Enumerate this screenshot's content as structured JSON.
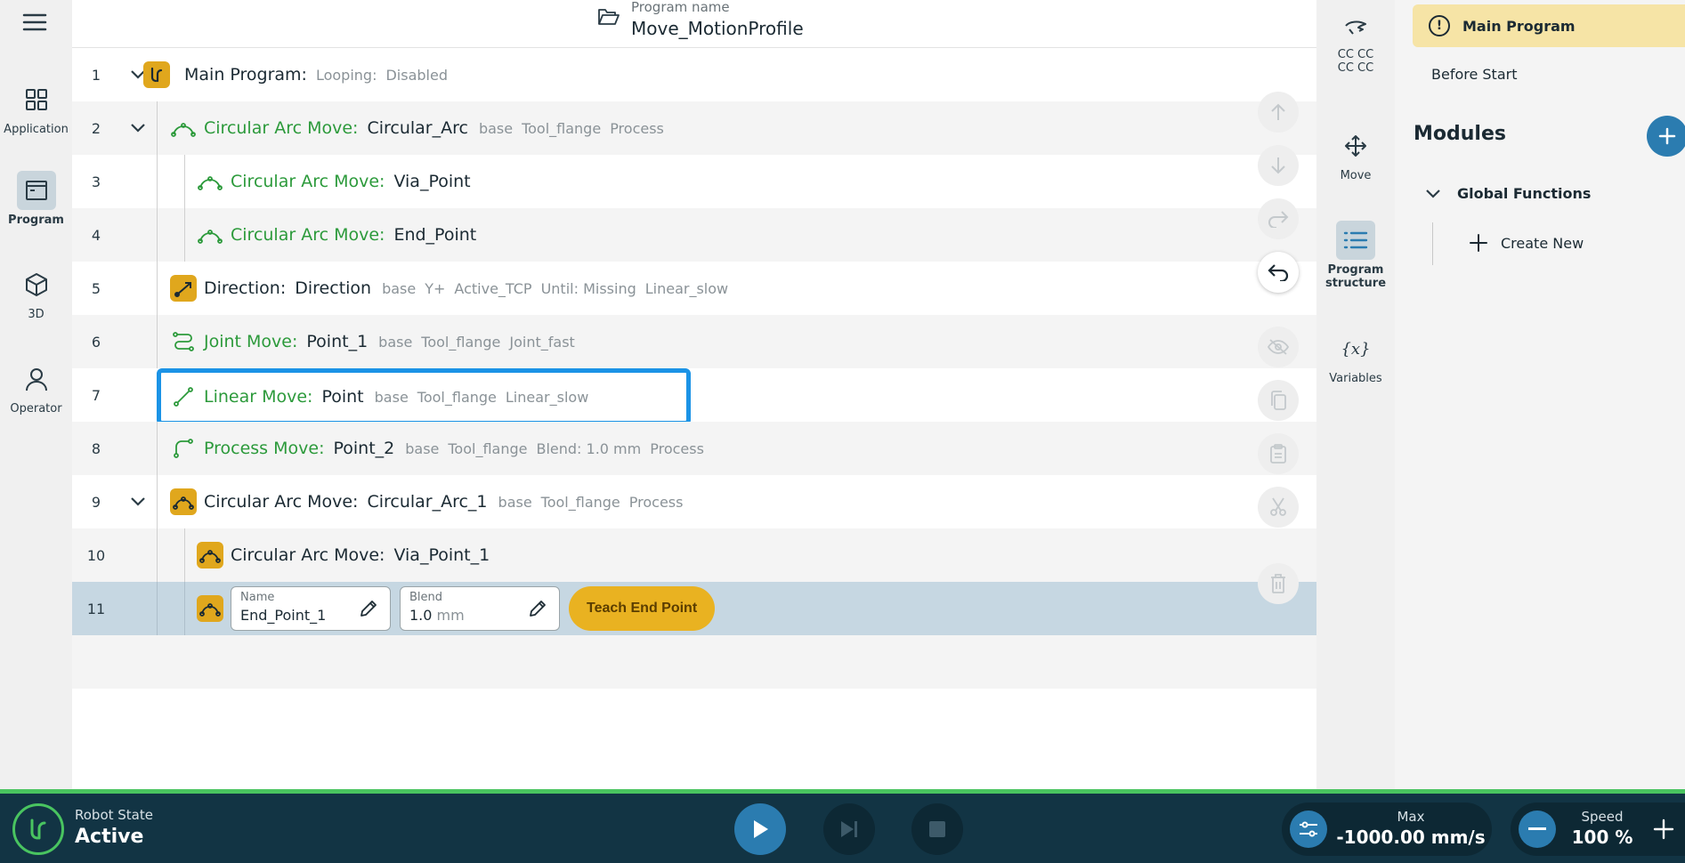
{
  "app": {
    "program_name_label": "Program name",
    "program_name": "Move_MotionProfile"
  },
  "left_nav": [
    {
      "label": "Application",
      "icon": "grid-icon"
    },
    {
      "label": "Program",
      "icon": "program-window-icon",
      "active": true
    },
    {
      "label": "3D",
      "icon": "cube-icon"
    },
    {
      "label": "Operator",
      "icon": "person-icon"
    }
  ],
  "rows": [
    {
      "num": "1",
      "label": "Main Program:",
      "tags": [
        "Looping:",
        "Disabled"
      ]
    },
    {
      "num": "2",
      "label": "Circular Arc Move:",
      "value": "Circular_Arc",
      "tags": [
        "base",
        "Tool_flange",
        "Process"
      ]
    },
    {
      "num": "3",
      "label": "Circular Arc Move:",
      "value": "Via_Point"
    },
    {
      "num": "4",
      "label": "Circular Arc Move:",
      "value": "End_Point"
    },
    {
      "num": "5",
      "label": "Direction:",
      "value": "Direction",
      "tags": [
        "base",
        "Y+",
        "Active_TCP",
        "Until: Missing",
        "Linear_slow"
      ]
    },
    {
      "num": "6",
      "label": "Joint Move:",
      "value": "Point_1",
      "tags": [
        "base",
        "Tool_flange",
        "Joint_fast"
      ]
    },
    {
      "num": "7",
      "label": "Linear Move:",
      "value": "Point",
      "tags": [
        "base",
        "Tool_flange",
        "Linear_slow"
      ]
    },
    {
      "num": "8",
      "label": "Process Move:",
      "value": "Point_2",
      "tags": [
        "base",
        "Tool_flange",
        "Blend: 1.0 mm",
        "Process"
      ]
    },
    {
      "num": "9",
      "label": "Circular Arc Move:",
      "value": "Circular_Arc_1",
      "tags": [
        "base",
        "Tool_flange",
        "Process"
      ]
    },
    {
      "num": "10",
      "label": "Circular Arc Move:",
      "value": "Via_Point_1"
    },
    {
      "num": "11",
      "name_label": "Name",
      "name_value": "End_Point_1",
      "blend_label": "Blend",
      "blend_value": "1.0",
      "blend_unit": "mm",
      "teach_label": "Teach End Point"
    }
  ],
  "tools": [
    {
      "label_line1": "CC CC",
      "label_line2": "CC CC",
      "icon": "hand-guide-icon"
    },
    {
      "label_line1": "Move",
      "icon": "move-arrows-icon"
    },
    {
      "label_line1": "Program",
      "label_line2": "structure",
      "icon": "list-icon",
      "active": true
    },
    {
      "label_line1": "Variables",
      "icon": "variables-icon"
    }
  ],
  "right_panel": {
    "main_program": "Main Program",
    "before_start": "Before Start",
    "modules": "Modules",
    "global_functions": "Global Functions",
    "create_new": "Create New"
  },
  "bottom": {
    "robot_state_label": "Robot State",
    "robot_state": "Active",
    "max_label": "Max",
    "max_value": "-1000.00 mm/s",
    "speed_label": "Speed",
    "speed_value": "100 %"
  },
  "colors": {
    "accent_blue": "#2b7cb0",
    "highlight_blue": "#1b93e6",
    "gold": "#e0a71d",
    "green_label": "#2c9a3b",
    "status_green": "#49c460",
    "bottom_bar": "#123444"
  }
}
